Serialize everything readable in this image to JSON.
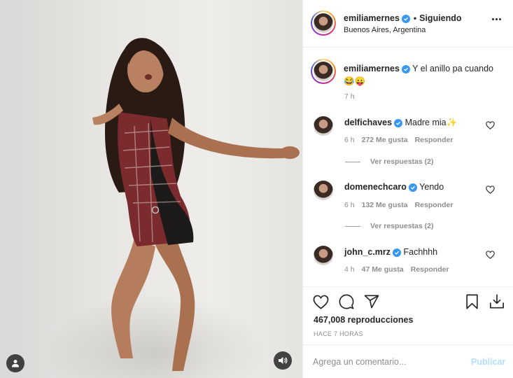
{
  "post": {
    "author": "emiliamernes",
    "follow_status": "Siguiendo",
    "location": "Buenos Aires, Argentina"
  },
  "caption": {
    "username": "emiliamernes",
    "text": "Y el anillo pa cuando",
    "emojis": "😂😛",
    "time": "7 h"
  },
  "comments": [
    {
      "username": "delfichaves",
      "text": "Madre mia✨",
      "time": "6 h",
      "likes": "272 Me gusta",
      "reply_label": "Responder",
      "replies_label": "Ver respuestas (2)"
    },
    {
      "username": "domenechcaro",
      "text": "Yendo",
      "time": "6 h",
      "likes": "132 Me gusta",
      "reply_label": "Responder",
      "replies_label": "Ver respuestas (2)"
    },
    {
      "username": "john_c.mrz",
      "text": "Fachhhh",
      "time": "4 h",
      "likes": "47 Me gusta",
      "reply_label": "Responder"
    }
  ],
  "stats": {
    "views": "467,008 reproducciones",
    "posted": "HACE 7 HORAS"
  },
  "comment_box": {
    "placeholder": "Agrega un comentario...",
    "publish_label": "Publicar"
  },
  "icons": {
    "verified": "verified-badge-icon",
    "more": "more-options-icon",
    "like": "heart-icon",
    "comment": "comment-icon",
    "share": "share-icon",
    "save": "bookmark-icon",
    "download": "download-icon",
    "user_tag": "user-tag-icon",
    "sound": "speaker-icon"
  },
  "colors": {
    "verified": "#3897f0",
    "publish_disabled": "#b2dffc",
    "secondary_text": "#8e8e8e"
  }
}
